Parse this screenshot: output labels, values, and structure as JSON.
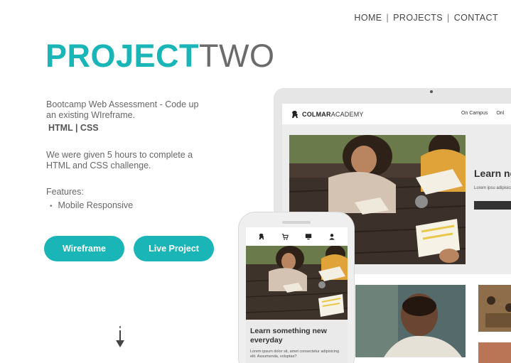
{
  "nav": {
    "home": "HOME",
    "projects": "PROJECTS",
    "contact": "CONTACT",
    "separator": "|"
  },
  "hero": {
    "title_bold": "PROJECT",
    "title_light": "TWO"
  },
  "intro": {
    "description": "Bootcamp Web Assessment - Code up an existing  WIreframe.",
    "tech": "HTML | CSS",
    "challenge": "We were given 5 hours to complete a HTML and CSS challenge.",
    "features_label": "Features:",
    "features": [
      "Mobile Responsive"
    ]
  },
  "buttons": {
    "wireframe": "Wireframe",
    "live": "Live Project"
  },
  "mockup": {
    "logo_bold": "COLMAR",
    "logo_light": "ACADEMY",
    "nav_items": [
      "On Campus",
      "Onl"
    ],
    "hero_title": "Learn something new everyday",
    "hero_text": "Lorem ipsum dolor sit, amet consectetur adipisicing elit. Assumenda, voluptas?",
    "side_title": "Learn new e",
    "side_text": "Lorem ipsu adipisicing"
  },
  "colors": {
    "accent": "#1ab5b7",
    "title_light": "#6b6b6b",
    "text": "#666666"
  },
  "icons": [
    "arrow-down-icon",
    "lion-logo-icon",
    "cart-icon",
    "monitor-icon",
    "user-icon"
  ]
}
